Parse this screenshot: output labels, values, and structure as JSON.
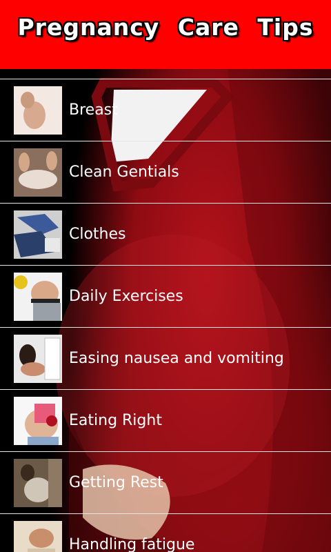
{
  "header": {
    "title": "Pregnancy  Care  Tips"
  },
  "topics": [
    {
      "label": "Breast",
      "icon": "breast-photo"
    },
    {
      "label": "Clean Gentials",
      "icon": "clean-photo"
    },
    {
      "label": "Clothes",
      "icon": "clothes-photo"
    },
    {
      "label": "Daily Exercises",
      "icon": "exercise-photo"
    },
    {
      "label": "Easing nausea and vomiting",
      "icon": "nausea-photo"
    },
    {
      "label": "Eating Right",
      "icon": "eating-photo"
    },
    {
      "label": "Getting Rest",
      "icon": "rest-photo"
    },
    {
      "label": "Handling fatigue",
      "icon": "fatigue-photo"
    }
  ],
  "colors": {
    "header": "#ff0000",
    "background_garment": "#a10f18",
    "text": "#ffffff",
    "divider": "#e6e6e6"
  }
}
